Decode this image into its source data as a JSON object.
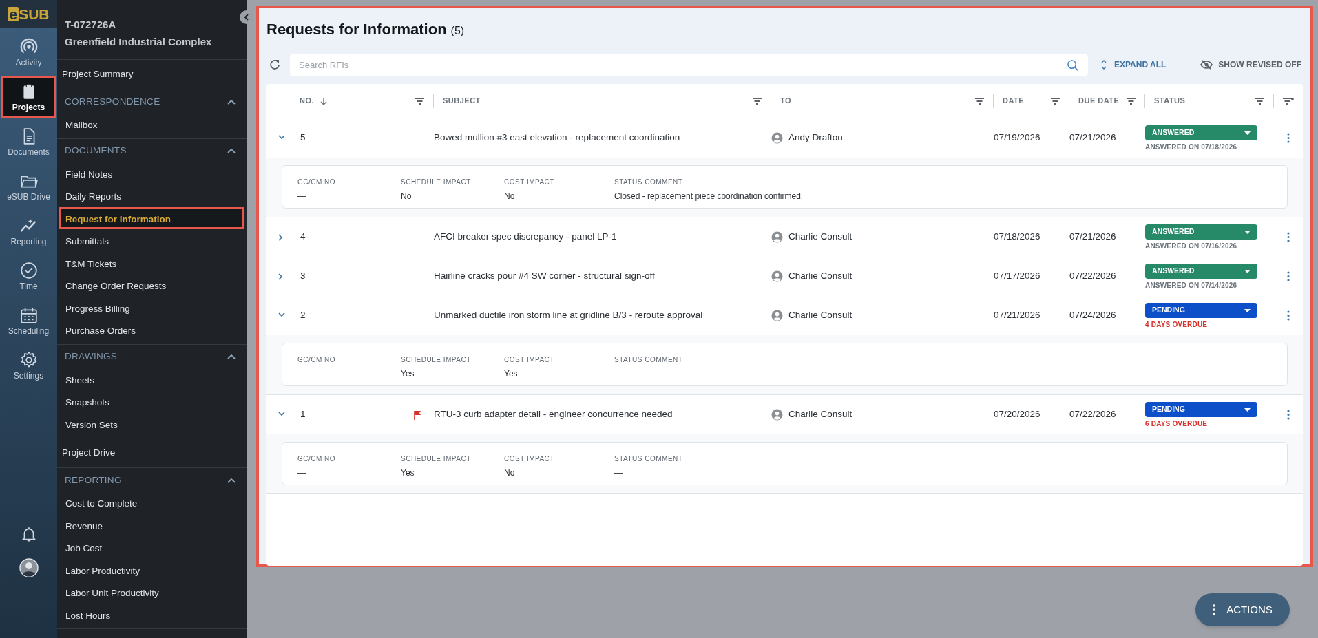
{
  "brand": {
    "logo_letter": "e",
    "logo_text": "SUB"
  },
  "rail": {
    "items": [
      {
        "kind": "activity",
        "label": "Activity",
        "selected": false
      },
      {
        "kind": "projects",
        "label": "Projects",
        "selected": true
      },
      {
        "kind": "documents",
        "label": "Documents",
        "selected": false
      },
      {
        "kind": "drive",
        "label": "eSUB Drive",
        "selected": false
      },
      {
        "kind": "reporting",
        "label": "Reporting",
        "selected": false
      },
      {
        "kind": "time",
        "label": "Time",
        "selected": false
      },
      {
        "kind": "scheduling",
        "label": "Scheduling",
        "selected": false
      },
      {
        "kind": "settings",
        "label": "Settings",
        "selected": false
      }
    ]
  },
  "sidebar": {
    "project_code": "T-072726A",
    "project_name": "Greenfield Industrial Complex",
    "sections": [
      {
        "kind": "link",
        "label": "Project Summary",
        "selected": false
      },
      {
        "kind": "group",
        "title": "CORRESPONDENCE",
        "expanded": true,
        "items": [
          {
            "label": "Mailbox",
            "selected": false
          }
        ]
      },
      {
        "kind": "group",
        "title": "DOCUMENTS",
        "expanded": true,
        "items": [
          {
            "label": "Field Notes",
            "selected": false
          },
          {
            "label": "Daily Reports",
            "selected": false
          },
          {
            "label": "Request for Information",
            "selected": true
          },
          {
            "label": "Submittals",
            "selected": false
          },
          {
            "label": "T&M Tickets",
            "selected": false
          },
          {
            "label": "Change Order Requests",
            "selected": false
          },
          {
            "label": "Progress Billing",
            "selected": false
          },
          {
            "label": "Purchase Orders",
            "selected": false
          }
        ]
      },
      {
        "kind": "group",
        "title": "DRAWINGS",
        "expanded": true,
        "items": [
          {
            "label": "Sheets",
            "selected": false
          },
          {
            "label": "Snapshots",
            "selected": false
          },
          {
            "label": "Version Sets",
            "selected": false
          }
        ]
      },
      {
        "kind": "link",
        "label": "Project Drive",
        "selected": false
      },
      {
        "kind": "group",
        "title": "REPORTING",
        "expanded": true,
        "items": [
          {
            "label": "Cost to Complete",
            "selected": false
          },
          {
            "label": "Revenue",
            "selected": false
          },
          {
            "label": "Job Cost",
            "selected": false
          },
          {
            "label": "Labor Productivity",
            "selected": false
          },
          {
            "label": "Labor Unit Productivity",
            "selected": false
          },
          {
            "label": "Lost Hours",
            "selected": false
          }
        ]
      }
    ]
  },
  "page": {
    "title": "Requests for Information",
    "count": "(5)"
  },
  "toolbar": {
    "search_placeholder": "Search RFIs",
    "expand_all": "EXPAND ALL",
    "show_revised": "SHOW REVISED OFF"
  },
  "table": {
    "columns": [
      {
        "label": "NO.",
        "sorted": true
      },
      {
        "label": "SUBJECT",
        "sorted": false
      },
      {
        "label": "TO",
        "sorted": false
      },
      {
        "label": "DATE",
        "sorted": false
      },
      {
        "label": "DUE DATE",
        "sorted": false
      },
      {
        "label": "STATUS",
        "sorted": false
      }
    ],
    "rows": [
      {
        "expanded": true,
        "no": "5",
        "flagged": false,
        "subject": "Bowed mullion #3 east elevation - replacement coordination",
        "to": "Andy Drafton",
        "date": "07/19/2026",
        "due_date": "07/21/2026",
        "status": {
          "kind": "answered",
          "label": "ANSWERED"
        },
        "status_note": "ANSWERED ON 07/18/2026",
        "details": [
          {
            "label": "GC/CM NO",
            "value": "—"
          },
          {
            "label": "SCHEDULE IMPACT",
            "value": "No"
          },
          {
            "label": "COST IMPACT",
            "value": "No"
          },
          {
            "label": "STATUS COMMENT",
            "value": "Closed - replacement piece coordination confirmed."
          }
        ]
      },
      {
        "expanded": false,
        "no": "4",
        "flagged": false,
        "subject": "AFCI breaker spec discrepancy - panel LP-1",
        "to": "Charlie Consult",
        "date": "07/18/2026",
        "due_date": "07/21/2026",
        "status": {
          "kind": "answered",
          "label": "ANSWERED"
        },
        "status_note": "ANSWERED ON 07/16/2026"
      },
      {
        "expanded": false,
        "no": "3",
        "flagged": false,
        "subject": "Hairline cracks pour #4 SW corner - structural sign-off",
        "to": "Charlie Consult",
        "date": "07/17/2026",
        "due_date": "07/22/2026",
        "status": {
          "kind": "answered",
          "label": "ANSWERED"
        },
        "status_note": "ANSWERED ON 07/14/2026"
      },
      {
        "expanded": true,
        "no": "2",
        "flagged": false,
        "subject": "Unmarked ductile iron storm line at gridline B/3 - reroute approval",
        "to": "Charlie Consult",
        "date": "07/21/2026",
        "due_date": "07/24/2026",
        "status": {
          "kind": "pending",
          "label": "PENDING"
        },
        "status_note": "4 DAYS OVERDUE",
        "details": [
          {
            "label": "GC/CM NO",
            "value": "—"
          },
          {
            "label": "SCHEDULE IMPACT",
            "value": "Yes"
          },
          {
            "label": "COST IMPACT",
            "value": "Yes"
          },
          {
            "label": "STATUS COMMENT",
            "value": "—"
          }
        ]
      },
      {
        "expanded": true,
        "no": "1",
        "flagged": true,
        "subject": "RTU-3 curb adapter detail - engineer concurrence needed",
        "to": "Charlie Consult",
        "date": "07/20/2026",
        "due_date": "07/22/2026",
        "status": {
          "kind": "pending",
          "label": "PENDING"
        },
        "status_note": "6 DAYS OVERDUE",
        "details": [
          {
            "label": "GC/CM NO",
            "value": "—"
          },
          {
            "label": "SCHEDULE IMPACT",
            "value": "Yes"
          },
          {
            "label": "COST IMPACT",
            "value": "No"
          },
          {
            "label": "STATUS COMMENT",
            "value": "—"
          }
        ]
      }
    ]
  },
  "actions_button": "ACTIONS"
}
